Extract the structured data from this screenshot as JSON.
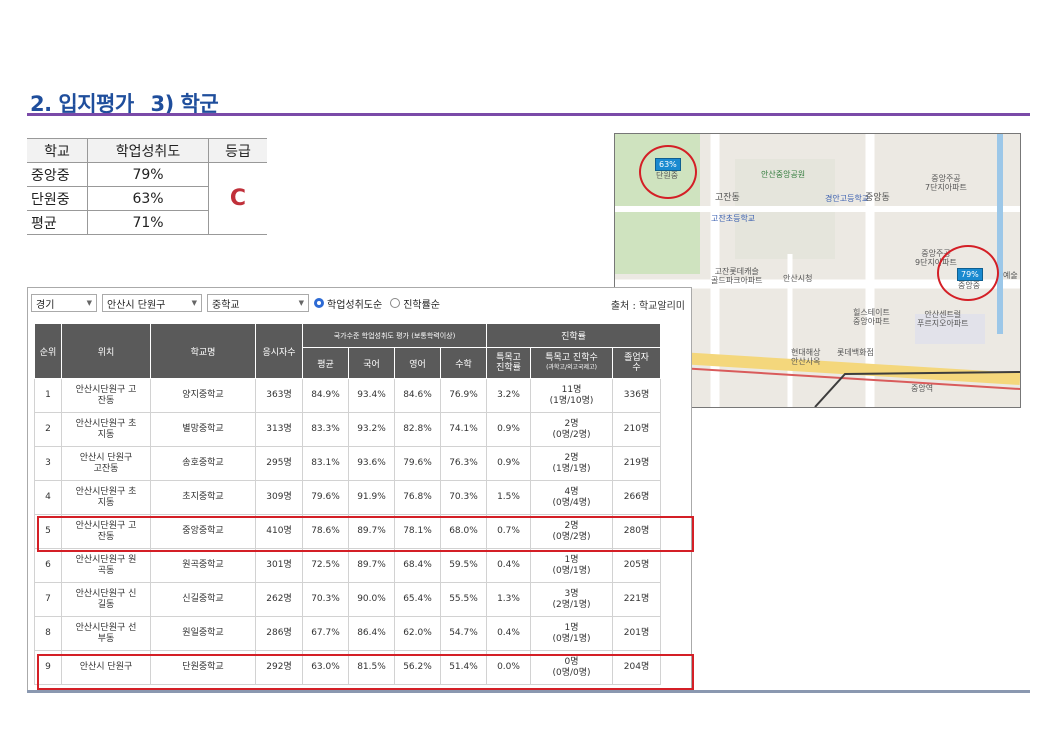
{
  "title": "2. 입지평가_ 3) 학군",
  "summary": {
    "headers": [
      "학교",
      "학업성취도",
      "등급"
    ],
    "rows": [
      {
        "name": "중앙중",
        "value": "79%"
      },
      {
        "name": "단원중",
        "value": "63%"
      },
      {
        "name": "평균",
        "value": "71%"
      }
    ],
    "grade": "C"
  },
  "map": {
    "labels": {
      "park": "안산중앙공원",
      "school1": "경안고등학교",
      "dong1": "고잔동",
      "dong2": "중앙동",
      "apt1": "중앙주공\n7단지아파트",
      "elem": "고잔초등학교",
      "apt2": "중앙주공\n9단지아파트",
      "golf": "고잔롯데캐슬\n골드파크아파트",
      "cityhall": "안산시청",
      "hills": "힐스테이트\n중앙아파트",
      "center": "안산센트럴\n푸르지오아파트",
      "hyundai": "현대해상\n안산사옥",
      "lotte": "롯데백화점",
      "station": "중앙역",
      "ye": "예술",
      "danwon": "단원중",
      "jungang": "중앙중"
    },
    "badges": {
      "danwon": "63%",
      "jungang": "79%"
    }
  },
  "filters": {
    "region": "경기",
    "district": "안산시 단원구",
    "level": "중학교",
    "radio1": "학업성취도순",
    "radio2": "진학률순",
    "source": "출처 : 학교알리미"
  },
  "table": {
    "h_rank": "순위",
    "h_loc": "위치",
    "h_school": "학교명",
    "h_count": "응시자수",
    "h_national": "국가수준 학업성취도 평가 (보통학력이상)",
    "h_adv": "진학률",
    "h_avg": "평균",
    "h_kor": "국어",
    "h_eng": "영어",
    "h_math": "수학",
    "h_special": "특목고\n진학률",
    "h_special_cnt": "특목고 진학수",
    "h_special_cnt_sub": "(과학고/외고국제고)",
    "h_grad": "졸업자\n수",
    "rows": [
      {
        "rank": "1",
        "loc": "안산시단원구 고\n잔동",
        "school": "양지중학교",
        "count": "363명",
        "avg": "84.9%",
        "kor": "93.4%",
        "eng": "84.6%",
        "math": "76.9%",
        "sp": "3.2%",
        "spc": "11명\n(1명/10명)",
        "grad": "336명"
      },
      {
        "rank": "2",
        "loc": "안산시단원구 초\n지동",
        "school": "별망중학교",
        "count": "313명",
        "avg": "83.3%",
        "kor": "93.2%",
        "eng": "82.8%",
        "math": "74.1%",
        "sp": "0.9%",
        "spc": "2명\n(0명/2명)",
        "grad": "210명"
      },
      {
        "rank": "3",
        "loc": "안산시 단원구\n고잔동",
        "school": "송호중학교",
        "count": "295명",
        "avg": "83.1%",
        "kor": "93.6%",
        "eng": "79.6%",
        "math": "76.3%",
        "sp": "0.9%",
        "spc": "2명\n(1명/1명)",
        "grad": "219명"
      },
      {
        "rank": "4",
        "loc": "안산시단원구 초\n지동",
        "school": "초지중학교",
        "count": "309명",
        "avg": "79.6%",
        "kor": "91.9%",
        "eng": "76.8%",
        "math": "70.3%",
        "sp": "1.5%",
        "spc": "4명\n(0명/4명)",
        "grad": "266명"
      },
      {
        "rank": "5",
        "loc": "안산시단원구 고\n잔동",
        "school": "중앙중학교",
        "count": "410명",
        "avg": "78.6%",
        "kor": "89.7%",
        "eng": "78.1%",
        "math": "68.0%",
        "sp": "0.7%",
        "spc": "2명\n(0명/2명)",
        "grad": "280명"
      },
      {
        "rank": "6",
        "loc": "안산시단원구 원\n곡동",
        "school": "원곡중학교",
        "count": "301명",
        "avg": "72.5%",
        "kor": "89.7%",
        "eng": "68.4%",
        "math": "59.5%",
        "sp": "0.4%",
        "spc": "1명\n(0명/1명)",
        "grad": "205명"
      },
      {
        "rank": "7",
        "loc": "안산시단원구 신\n길동",
        "school": "신길중학교",
        "count": "262명",
        "avg": "70.3%",
        "kor": "90.0%",
        "eng": "65.4%",
        "math": "55.5%",
        "sp": "1.3%",
        "spc": "3명\n(2명/1명)",
        "grad": "221명"
      },
      {
        "rank": "8",
        "loc": "안산시단원구 선\n부동",
        "school": "원일중학교",
        "count": "286명",
        "avg": "67.7%",
        "kor": "86.4%",
        "eng": "62.0%",
        "math": "54.7%",
        "sp": "0.4%",
        "spc": "1명\n(0명/1명)",
        "grad": "201명"
      },
      {
        "rank": "9",
        "loc": "안산시 단원구",
        "school": "단원중학교",
        "count": "292명",
        "avg": "63.0%",
        "kor": "81.5%",
        "eng": "56.2%",
        "math": "51.4%",
        "sp": "0.0%",
        "spc": "0명\n(0명/0명)",
        "grad": "204명"
      }
    ]
  }
}
